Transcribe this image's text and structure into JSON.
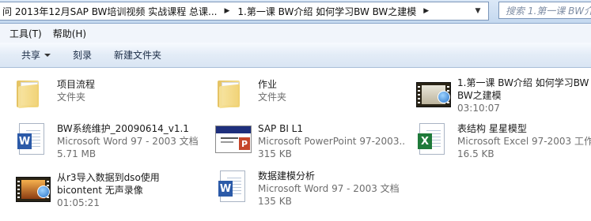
{
  "address": {
    "crumb_parent": "问 2013年12月SAP BW培训视频 实战课程 总课...",
    "crumb_current": "1.第一课 BW介绍 如何学习BW BW之建模",
    "search_placeholder": "搜索 1.第一课 BW介绍"
  },
  "menu": {
    "items": [
      "工具(T)",
      "帮助(H)"
    ]
  },
  "toolbar": {
    "share": "共享",
    "burn": "刻录",
    "new_folder": "新建文件夹"
  },
  "files": [
    {
      "name": "项目流程",
      "type": "文件夹",
      "detail": "",
      "icon": "folder-icon"
    },
    {
      "name": "作业",
      "type": "文件夹",
      "detail": "",
      "icon": "folder-icon"
    },
    {
      "name": "1.第一课 BW介绍 如何学习BW BW之建模",
      "type": "",
      "detail": "03:10:07",
      "icon": "video-icon"
    },
    {
      "name": "BW系统维护_20090614_v1.1",
      "type": "Microsoft Word 97 - 2003 文档",
      "detail": "5.71 MB",
      "icon": "word-doc-icon"
    },
    {
      "name": "SAP BI  L1",
      "type": "Microsoft PowerPoint 97-2003...",
      "detail": "315 KB",
      "icon": "powerpoint-icon"
    },
    {
      "name": "表结构 星星模型",
      "type": "Microsoft Excel 97-2003 工作表",
      "detail": "16.5 KB",
      "icon": "excel-icon"
    },
    {
      "name": "从r3导入数据到dso使用bicontent 无声录像",
      "type": "",
      "detail": "01:05:21",
      "icon": "video-icon"
    },
    {
      "name": "数据建模分析",
      "type": "Microsoft Word 97 - 2003 文档",
      "detail": "135 KB",
      "icon": "word-doc-icon"
    }
  ]
}
